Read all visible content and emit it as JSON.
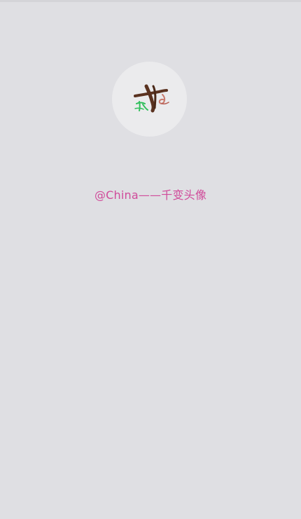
{
  "profile": {
    "handle": "@China——千变头像",
    "avatar": {
      "icon": "calligraphy-avatar-icon",
      "background_color": "#ebebed",
      "stroke_color": "#5a3220",
      "accent_color": "#2fbf5b",
      "detail_color": "#c97a6d"
    },
    "handle_color": "#d04b9a"
  },
  "screen": {
    "background_color": "#dfdfe3"
  }
}
